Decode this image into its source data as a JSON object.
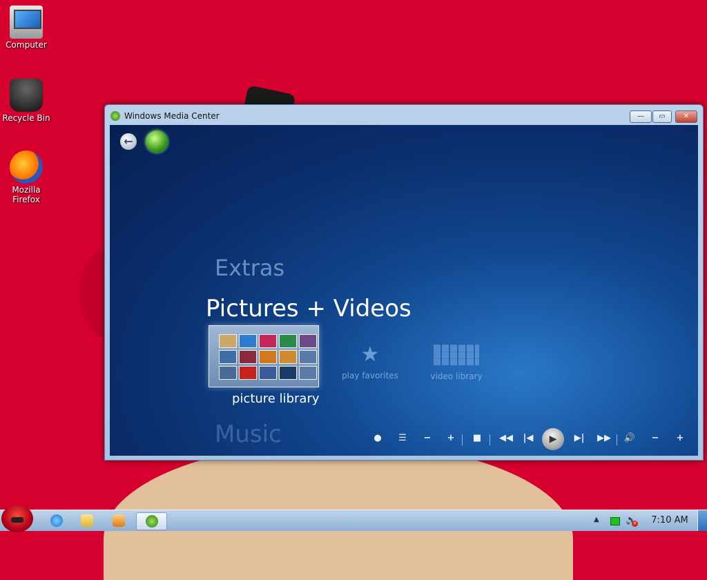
{
  "desktop": {
    "icons": [
      {
        "label": "Computer",
        "icon": "computer-icon"
      },
      {
        "label": "Recycle Bin",
        "icon": "recycle-bin-icon"
      },
      {
        "label": "Mozilla Firefox",
        "icon": "firefox-icon"
      }
    ]
  },
  "window": {
    "title": "Windows Media Center",
    "controls": {
      "minimize": "—",
      "maximize": "▭",
      "close": "✕"
    }
  },
  "media_center": {
    "menu": {
      "extras": "Extras",
      "pictures_videos": "Pictures + Videos",
      "music": "Music"
    },
    "tiles": {
      "picture_library": "picture library",
      "play_favorites": "play favorites",
      "video_library": "video library"
    },
    "transport": {
      "record": "●",
      "guide": "☰",
      "ch_down": "−",
      "ch_up": "+",
      "stop": "■",
      "rewind": "◀◀",
      "prev": "|◀",
      "play": "▶",
      "next": "▶|",
      "ffwd": "▶▶",
      "mute": "🔊",
      "vol_down": "−",
      "vol_up": "+"
    }
  },
  "taskbar": {
    "clock": "7:10 AM",
    "pinned": [
      "internet-explorer-icon",
      "folder-icon",
      "media-player-icon",
      "media-center-icon"
    ]
  },
  "colors": {
    "desktop_bg": "#d6002e",
    "mc_bg": "#0b2f6e",
    "taskbar": "#a9c4e2"
  }
}
